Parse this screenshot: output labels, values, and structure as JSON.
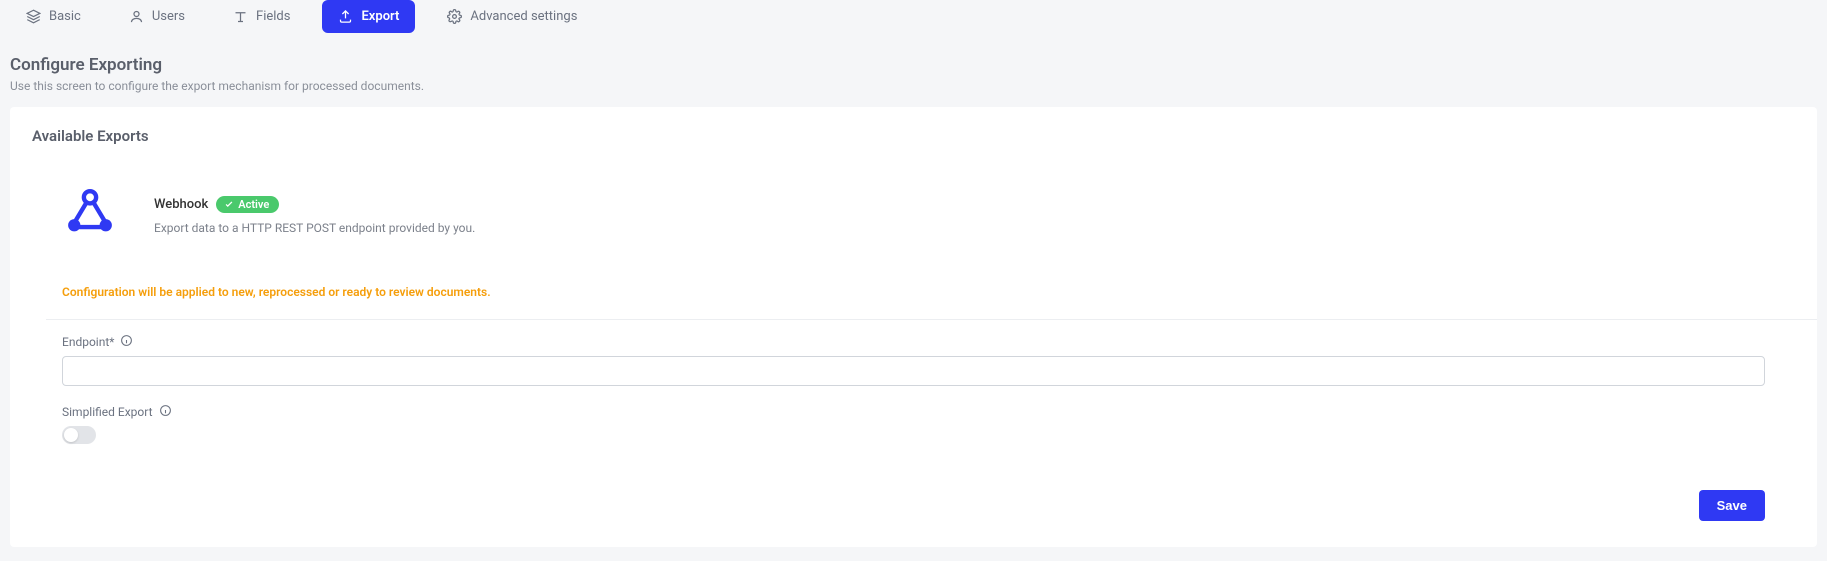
{
  "tabs": {
    "basic": "Basic",
    "users": "Users",
    "fields": "Fields",
    "export": "Export",
    "advanced": "Advanced settings"
  },
  "header": {
    "title": "Configure Exporting",
    "subtitle": "Use this screen to configure the export mechanism for processed documents."
  },
  "panel": {
    "title": "Available Exports",
    "webhook": {
      "title": "Webhook",
      "badge": "Active",
      "desc": "Export data to a HTTP REST POST endpoint provided by you."
    },
    "warning": "Configuration will be applied to new, reprocessed or ready to review documents.",
    "fields": {
      "endpoint_label": "Endpoint*",
      "endpoint_value": "",
      "simplified_label": "Simplified Export",
      "simplified_on": false
    },
    "save_label": "Save"
  }
}
